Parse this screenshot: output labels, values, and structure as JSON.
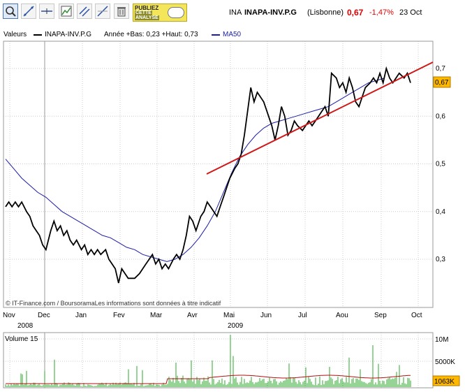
{
  "header": {
    "code": "INA",
    "name": "INAPA-INV.P.G",
    "exchange": "(Lisbonne)",
    "price": "0,67",
    "change": "-1,47%",
    "date": "23 Oct"
  },
  "toolbar": {
    "tools": [
      "zoom-tool-icon",
      "line-tool-icon",
      "horizontal-line-tool-icon",
      "indicator-tool-icon",
      "parallel-lines-tool-icon",
      "fibonacci-tool-icon",
      "trash-icon"
    ],
    "publish_line1": "PUBLIEZ",
    "publish_line2": "CETTE",
    "publish_line3": "ANALYSE"
  },
  "legend": {
    "values_label": "Valeurs",
    "series_name": "INAPA-INV.P.G",
    "range_text": "Année +Bas: 0,23 +Haut: 0,73",
    "ma_name": "MA50"
  },
  "copyright": "© IT-Finance.com / BoursoramaLes informations sont données à titre indicatif",
  "volume_label": "Volume 15",
  "colors": {
    "price": "#000000",
    "ma": "#1c1ca8",
    "trend": "#d01818",
    "volume_bar": "#2ca82c",
    "volume_ma": "#b01010",
    "negative": "#e00000"
  },
  "chart_data": [
    {
      "type": "line",
      "title": "INAPA-INV.P.G",
      "ylim": [
        0.22,
        0.73
      ],
      "y_ticks": [
        "0,7",
        "0,6",
        "0,5",
        "0,4",
        "0,3"
      ],
      "x_ticks": [
        "Nov",
        "Dec",
        "Jan",
        "Fev",
        "Mar",
        "Avr",
        "Mai",
        "Jun",
        "Jul",
        "Aou",
        "Sep",
        "Oct"
      ],
      "year_labels": [
        "2008",
        "2009"
      ],
      "last_value_label": "0,67",
      "x": [
        0,
        2,
        4,
        6,
        8,
        10,
        13,
        15,
        17,
        19,
        21,
        23,
        25,
        28,
        30,
        32,
        34,
        36,
        38,
        40,
        42,
        44,
        47,
        49,
        51,
        53,
        55,
        57,
        59,
        62,
        64,
        66,
        68,
        70,
        72,
        74,
        76,
        78,
        80,
        83,
        85,
        87,
        89,
        91,
        93,
        95,
        97,
        99,
        101,
        104,
        106,
        108,
        110,
        112,
        114,
        116,
        118,
        121,
        123,
        125,
        127,
        129,
        131,
        133,
        135,
        137,
        139,
        142,
        144,
        146,
        148,
        150,
        152,
        154,
        156,
        158,
        160,
        163,
        165,
        167,
        169,
        171,
        173,
        175,
        177,
        179,
        181,
        184,
        186,
        188,
        190,
        192,
        194,
        196,
        198,
        200,
        202,
        205,
        207,
        209,
        211,
        213,
        215,
        217,
        219,
        221,
        223,
        226,
        228,
        230,
        232,
        234,
        236,
        238,
        240,
        242,
        244,
        247,
        249,
        251
      ],
      "series": [
        {
          "name": "INAPA-INV.P.G",
          "values": [
            0.41,
            0.42,
            0.41,
            0.42,
            0.41,
            0.42,
            0.4,
            0.39,
            0.37,
            0.36,
            0.35,
            0.33,
            0.32,
            0.36,
            0.38,
            0.36,
            0.37,
            0.35,
            0.36,
            0.34,
            0.33,
            0.34,
            0.32,
            0.33,
            0.31,
            0.32,
            0.31,
            0.32,
            0.31,
            0.32,
            0.3,
            0.29,
            0.28,
            0.25,
            0.28,
            0.27,
            0.26,
            0.26,
            0.26,
            0.27,
            0.28,
            0.29,
            0.3,
            0.31,
            0.29,
            0.3,
            0.28,
            0.29,
            0.28,
            0.3,
            0.31,
            0.3,
            0.32,
            0.35,
            0.39,
            0.38,
            0.36,
            0.39,
            0.4,
            0.42,
            0.41,
            0.4,
            0.39,
            0.41,
            0.43,
            0.45,
            0.47,
            0.49,
            0.5,
            0.52,
            0.56,
            0.61,
            0.66,
            0.63,
            0.65,
            0.64,
            0.63,
            0.6,
            0.58,
            0.55,
            0.58,
            0.62,
            0.6,
            0.56,
            0.57,
            0.59,
            0.58,
            0.57,
            0.58,
            0.59,
            0.58,
            0.59,
            0.6,
            0.61,
            0.62,
            0.6,
            0.69,
            0.68,
            0.66,
            0.67,
            0.65,
            0.68,
            0.66,
            0.63,
            0.62,
            0.64,
            0.66,
            0.67,
            0.68,
            0.67,
            0.69,
            0.67,
            0.7,
            0.68,
            0.67,
            0.68,
            0.69,
            0.68,
            0.69,
            0.67
          ]
        },
        {
          "name": "MA50",
          "values": [
            0.51,
            0.49,
            0.47,
            0.455,
            0.44,
            0.43,
            0.415,
            0.4,
            0.39,
            0.38,
            0.37,
            0.36,
            0.35,
            0.345,
            0.335,
            0.325,
            0.32,
            0.31,
            0.305,
            0.3,
            0.295,
            0.3,
            0.31,
            0.325,
            0.345,
            0.37,
            0.4,
            0.44,
            0.48,
            0.515,
            0.54,
            0.56,
            0.575,
            0.585,
            0.59,
            0.595,
            0.6,
            0.605,
            0.61,
            0.615,
            0.62,
            0.63,
            0.64,
            0.65,
            0.66,
            0.67,
            0.675,
            0.68
          ],
          "x": [
            0,
            5,
            10,
            15,
            20,
            25,
            30,
            35,
            40,
            45,
            50,
            55,
            60,
            65,
            70,
            75,
            80,
            85,
            90,
            95,
            100,
            105,
            110,
            115,
            120,
            125,
            130,
            135,
            140,
            145,
            150,
            155,
            160,
            165,
            170,
            175,
            180,
            185,
            190,
            195,
            200,
            205,
            210,
            215,
            220,
            225,
            230,
            235
          ]
        }
      ]
    },
    {
      "type": "bar",
      "title": "Volume 15",
      "y_ticks": [
        "10M",
        "5000K"
      ],
      "last_value_label": "1063K"
    }
  ]
}
